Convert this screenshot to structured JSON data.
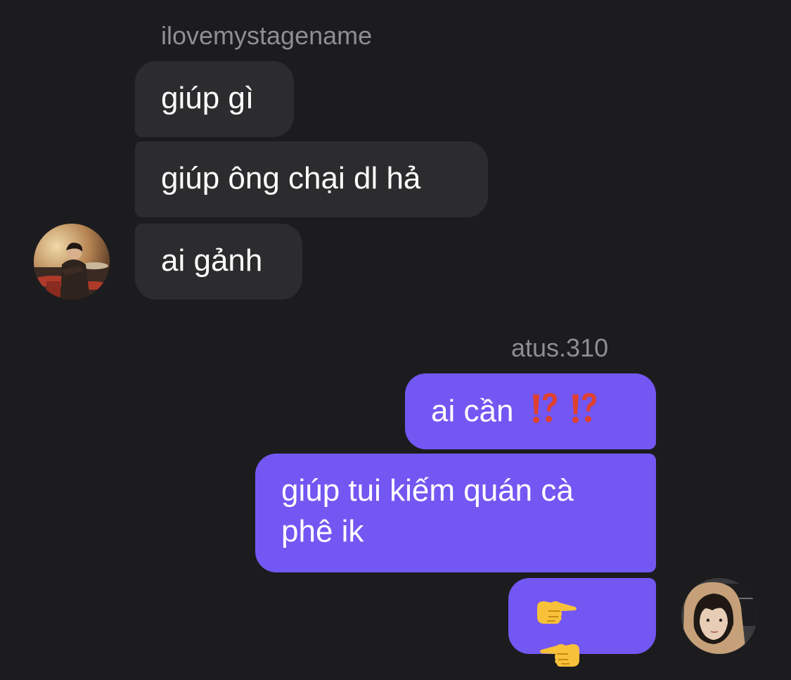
{
  "thread": {
    "incoming_sender": "ilovemystagename",
    "incoming_messages": [
      "giúp gì",
      "giúp ông chại dl hả",
      "ai gảnh"
    ],
    "outgoing_sender": "atus.310",
    "outgoing_messages": [
      "ai cần",
      "giúp tui kiếm quán cà phê ik"
    ]
  },
  "emojis": {
    "interrobang": "⁉️",
    "pointing_right": "👉",
    "pointing_left": "👈"
  },
  "icons": {
    "interrobang": "exclamation-question-mark-icon",
    "pointing_hands": "backhand-index-pointing-icon",
    "avatar_left": "user-avatar-photo",
    "avatar_right": "user-avatar-photo"
  },
  "colors": {
    "background": "#1c1c1e",
    "incoming_bubble": "#2c2c2e",
    "outgoing_bubble": "#7357f2",
    "sender_name": "#8e8e93",
    "text": "#ffffff",
    "emoji_red": "#e0402e"
  }
}
